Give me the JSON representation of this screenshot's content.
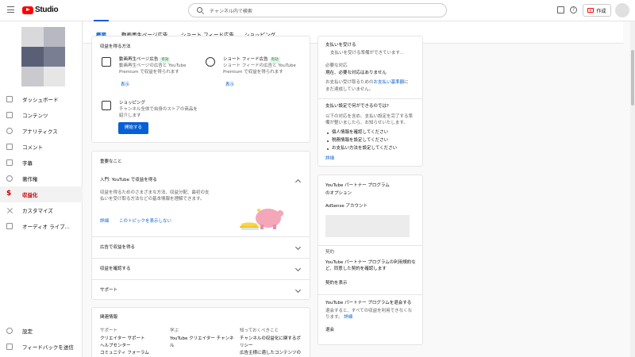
{
  "app": {
    "name": "Studio"
  },
  "search": {
    "placeholder": "チャンネル内で検索"
  },
  "header": {
    "create_label": "作成"
  },
  "sidebar": {
    "items": [
      {
        "label": "ダッシュボード",
        "icon": "dashboard-icon"
      },
      {
        "label": "コンテンツ",
        "icon": "content-icon"
      },
      {
        "label": "アナリティクス",
        "icon": "analytics-icon"
      },
      {
        "label": "コメント",
        "icon": "comment-icon"
      },
      {
        "label": "字幕",
        "icon": "subtitles-icon"
      },
      {
        "label": "著作権",
        "icon": "copyright-icon"
      },
      {
        "label": "収益化",
        "icon": "monetization-icon",
        "active": true
      },
      {
        "label": "カスタマイズ",
        "icon": "customize-icon"
      },
      {
        "label": "オーディオ ライブ...",
        "icon": "audio-library-icon"
      }
    ],
    "bottom": [
      {
        "label": "設定",
        "icon": "settings-icon"
      },
      {
        "label": "フィードバックを送信",
        "icon": "feedback-icon"
      }
    ]
  },
  "tabs": [
    "概要",
    "動画再生ページ広告",
    "ショート フィード広告",
    "ショッピング"
  ],
  "earn": {
    "title": "収益を得る方法",
    "watch_ads": {
      "title": "動画再生ページ広告",
      "badge": "有効",
      "line1": "動画再生ページの広告と YouTube",
      "line2": "Premium で収益を得られます",
      "link": "表示"
    },
    "shorts_ads": {
      "title": "ショート フィード広告",
      "badge": "有効",
      "line1": "ショート フィードの広告と YouTube",
      "line2": "Premium で収益を得られます",
      "link": "表示"
    },
    "shopping": {
      "title": "ショッピング",
      "line1": "チャンネル全体で自身のストアの商品を",
      "line2": "紹介します",
      "button": "開始する"
    }
  },
  "important": {
    "title": "重要なこと",
    "item1": {
      "title": "入門: YouTube で収益を得る",
      "line1": "収益を得るためのさまざまな方法、収益分配、最初の支",
      "line2": "払いを受け取る方法などの基本情報を理解できます。",
      "link": "詳細",
      "hide": "このトピックを表示しない"
    },
    "rows": [
      "広告で収益を得る",
      "収益を確認する",
      "サポート"
    ]
  },
  "related": {
    "title": "関連情報",
    "col1": {
      "head": "サポート",
      "items": [
        "クリエイター サポート",
        "ヘルプセンター",
        "コミュニティ フォーラム"
      ]
    },
    "col2": {
      "head": "学ぶ",
      "items": [
        "YouTube クリエイター チャンネ",
        "ル"
      ]
    },
    "col3": {
      "head": "知っておくべきこと",
      "items": [
        "チャンネルの収益化に関するポ",
        "リシー",
        "広告主様に適したコンテンツの"
      ]
    }
  },
  "payments": {
    "title": "支払いを受ける",
    "subtitle": "支払いを受ける準備ができています...",
    "action_head": "必要な対応",
    "action_text": "現在、必要な対応はありません",
    "info1": "お支払い受け取るための",
    "info_link": "お支払い基準額",
    "info2": "に",
    "info3": "まだ達成していません。",
    "setup_head": "支払い設定で何ができるのでは?",
    "setup_l1": "以下の対応を含め、支払い設定を完了する準",
    "setup_l2": "備が整いましたら、お知らせいたします。",
    "bullets": [
      "個人情報を確認してください",
      "税務情報を設定してください",
      "お支払い方法を設定してください"
    ],
    "link": "詳細"
  },
  "ypp": {
    "title_l1": "YouTube パートナー プログラム",
    "title_l2": "のオプション",
    "adsense_label": "AdSense アカウント",
    "contract_head": "契約",
    "contract_l1": "YouTube パートナー プログラムの利用規約な",
    "contract_l2": "ど、同意した契約を確認します",
    "contract_link": "契約を表示",
    "leave_head": "YouTube パートナー プログラムを退会する",
    "leave_l1": "退会すると、すべての収益を利用できなくな",
    "leave_l2": "ります。",
    "leave_link": "詳細",
    "leave_action": "退会"
  }
}
